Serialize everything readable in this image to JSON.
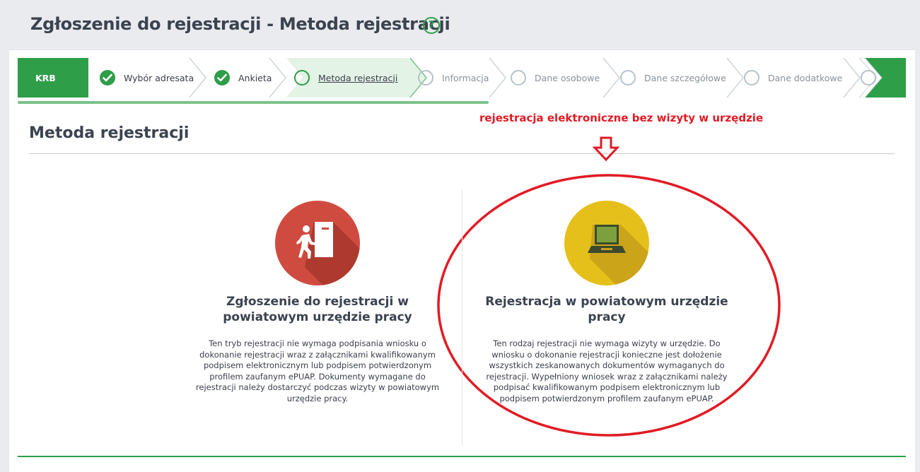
{
  "header": {
    "title": "Zgłoszenie do rejestracji - Metoda rejestracji",
    "help_icon": "?"
  },
  "stepper": {
    "krb": "KRB",
    "steps": [
      {
        "label": "Wybór adresata",
        "state": "done"
      },
      {
        "label": "Ankieta",
        "state": "done"
      },
      {
        "label": "Metoda rejestracji",
        "state": "current"
      },
      {
        "label": "Informacja",
        "state": "todo"
      },
      {
        "label": "Dane osobowe",
        "state": "todo"
      },
      {
        "label": "Dane szczegółowe",
        "state": "todo"
      },
      {
        "label": "Dane dodatkowe",
        "state": "todo"
      }
    ],
    "progress_fraction": 0.53
  },
  "section": {
    "title": "Metoda rejestracji"
  },
  "annotation": {
    "text": "rejestracja elektroniczne bez wizyty w urzędzie",
    "color": "#e21b24"
  },
  "options": [
    {
      "icon": "person-door-icon",
      "color": "#cf4b40",
      "title": "Zgłoszenie do rejestracji w powiatowym urzędzie pracy",
      "description": "Ten tryb rejestracji nie wymaga podpisania wniosku o dokonanie rejestracji wraz z załącznikami kwalifikowanym podpisem elektronicznym lub podpisem potwierdzonym profilem zaufanym ePUAP. Dokumenty wymagane do rejestracji należy dostarczyć podczas wizyty w powiatowym urzędzie pracy."
    },
    {
      "icon": "laptop-icon",
      "color": "#e6c01a",
      "title": "Rejestracja w powiatowym urzędzie pracy",
      "description": "Ten rodzaj rejestracji nie wymaga wizyty w urzędzie. Do wniosku o dokonanie rejestracji konieczne jest dołożenie wszystkich zeskanowanych dokumentów wymaganych do rejestracji. Wypełniony wniosek wraz z załącznikami należy podpisać kwalifikowanym podpisem elektronicznym lub podpisem potwierdzonym profilem zaufanym ePUAP."
    }
  ],
  "colors": {
    "brand_green": "#2e9e48",
    "light_green": "#e3f3e6",
    "accent_red": "#e21b24"
  }
}
